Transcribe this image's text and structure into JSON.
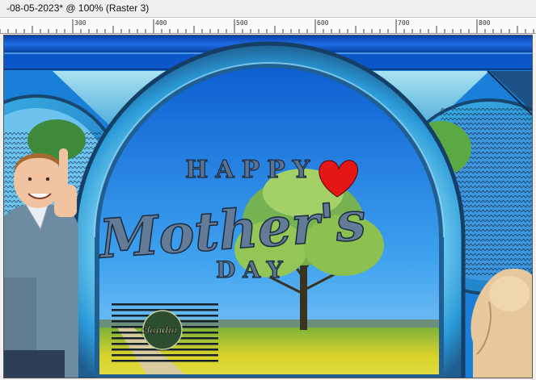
{
  "window": {
    "title": "-08-05-2023* @ 100% (Raster 3)"
  },
  "ruler": {
    "labels": [
      "300",
      "400",
      "500",
      "600",
      "700",
      "800"
    ]
  },
  "artwork": {
    "line_happy": "HAPPY",
    "line_mothers": "Mother's",
    "line_day": "DAY",
    "watermark": "claudia",
    "colors": {
      "sky": "#1e7fe0",
      "frame_ring": "#3fb0e8",
      "frame_dark": "#1d4f78",
      "lettering": "#5d7590",
      "heart": "#e81818",
      "grass": "#e0d82a"
    },
    "icons": [
      "heart-icon",
      "boy-thumbs-up-image",
      "tree-image",
      "statue-head-image"
    ]
  }
}
